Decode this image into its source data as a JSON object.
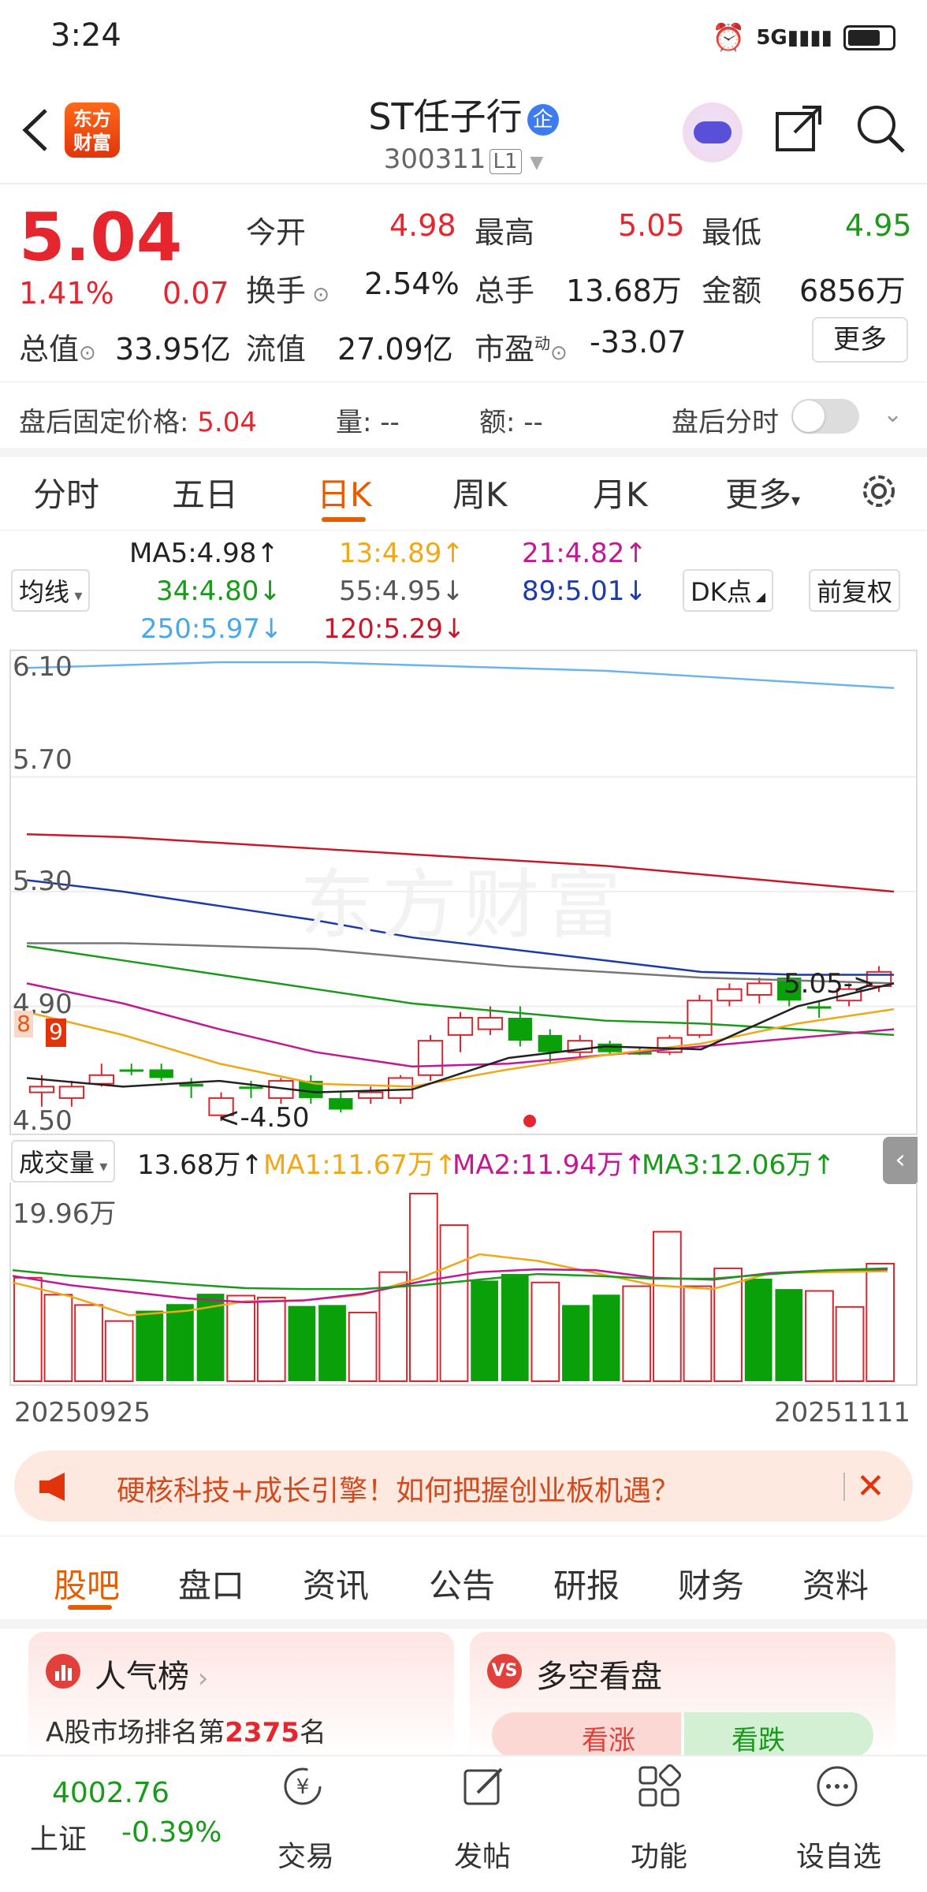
{
  "status": {
    "time": "3:24"
  },
  "header": {
    "title": "ST任子行",
    "badge": "企",
    "code": "300311",
    "level": "L1",
    "logo": "东方\n财富"
  },
  "quote": {
    "price": "5.04",
    "change_pct": "1.41%",
    "change": "0.07",
    "open_label": "今开",
    "open": "4.98",
    "high_label": "最高",
    "high": "5.05",
    "low_label": "最低",
    "low": "4.95",
    "turnover_label": "换手",
    "turnover": "2.54%",
    "volume_label": "总手",
    "volume": "13.68万",
    "amount_label": "金额",
    "amount": "6856万",
    "mktcap_label": "总值",
    "mktcap": "33.95亿",
    "float_label": "流值",
    "float": "27.09亿",
    "pe_label": "市盈",
    "pe_sup": "动",
    "pe": "-33.07",
    "more": "更多",
    "after_label": "盘后固定价格:",
    "after_price": "5.04",
    "after_vol": "量: --",
    "after_amt": "额: --",
    "after_time_label": "盘后分时"
  },
  "tabs": [
    "分时",
    "五日",
    "日K",
    "周K",
    "月K",
    "更多"
  ],
  "ma": {
    "select": "均线",
    "ma5": "MA5:4.98↑",
    "ma13": "13:4.89↑",
    "ma21": "21:4.82↑",
    "ma34": "34:4.80↓",
    "ma55": "55:4.95↓",
    "ma89": "89:5.01↓",
    "ma250": "250:5.97↓",
    "ma120": "120:5.29↓",
    "dk": "DK点",
    "adjust": "前复权"
  },
  "chart": {
    "y_labels": [
      "6.10",
      "5.70",
      "5.30",
      "4.90",
      "4.50"
    ],
    "annot_low": "<-4.50",
    "annot_high": "5.05->",
    "marker_8": "8",
    "marker_9": "9",
    "watermark": "东方财富"
  },
  "volume": {
    "select": "成交量",
    "vol": "13.68万↑",
    "ma1": "MA1:11.67万↑",
    "ma2": "MA2:11.94万↑",
    "ma3": "MA3:12.06万↑",
    "max": "19.96万",
    "date_start": "20250925",
    "date_end": "20251111"
  },
  "chart_data": {
    "type": "candlestick",
    "ylim": [
      4.5,
      6.1
    ],
    "candles": [
      {
        "o": 4.62,
        "c": 4.6,
        "h": 4.66,
        "l": 4.55,
        "up": true
      },
      {
        "o": 4.58,
        "c": 4.62,
        "h": 4.64,
        "l": 4.55,
        "up": true
      },
      {
        "o": 4.63,
        "c": 4.66,
        "h": 4.7,
        "l": 4.62,
        "up": true
      },
      {
        "o": 4.68,
        "c": 4.68,
        "h": 4.7,
        "l": 4.66,
        "up": false
      },
      {
        "o": 4.68,
        "c": 4.65,
        "h": 4.7,
        "l": 4.64,
        "up": false
      },
      {
        "o": 4.63,
        "c": 4.62,
        "h": 4.65,
        "l": 4.58,
        "up": false
      },
      {
        "o": 4.52,
        "c": 4.58,
        "h": 4.6,
        "l": 4.5,
        "up": true
      },
      {
        "o": 4.62,
        "c": 4.62,
        "h": 4.64,
        "l": 4.58,
        "up": false
      },
      {
        "o": 4.58,
        "c": 4.64,
        "h": 4.65,
        "l": 4.56,
        "up": true
      },
      {
        "o": 4.64,
        "c": 4.58,
        "h": 4.66,
        "l": 4.56,
        "up": false
      },
      {
        "o": 4.58,
        "c": 4.54,
        "h": 4.6,
        "l": 4.53,
        "up": false
      },
      {
        "o": 4.58,
        "c": 4.6,
        "h": 4.62,
        "l": 4.56,
        "up": true
      },
      {
        "o": 4.58,
        "c": 4.65,
        "h": 4.66,
        "l": 4.56,
        "up": true
      },
      {
        "o": 4.66,
        "c": 4.78,
        "h": 4.8,
        "l": 4.64,
        "up": true
      },
      {
        "o": 4.8,
        "c": 4.86,
        "h": 4.88,
        "l": 4.74,
        "up": true
      },
      {
        "o": 4.82,
        "c": 4.86,
        "h": 4.9,
        "l": 4.8,
        "up": true
      },
      {
        "o": 4.86,
        "c": 4.78,
        "h": 4.9,
        "l": 4.76,
        "up": false
      },
      {
        "o": 4.8,
        "c": 4.74,
        "h": 4.82,
        "l": 4.7,
        "up": false
      },
      {
        "o": 4.74,
        "c": 4.78,
        "h": 4.8,
        "l": 4.72,
        "up": true
      },
      {
        "o": 4.77,
        "c": 4.74,
        "h": 4.78,
        "l": 4.73,
        "up": false
      },
      {
        "o": 4.74,
        "c": 4.74,
        "h": 4.76,
        "l": 4.73,
        "up": false
      },
      {
        "o": 4.74,
        "c": 4.79,
        "h": 4.8,
        "l": 4.73,
        "up": true
      },
      {
        "o": 4.8,
        "c": 4.92,
        "h": 4.94,
        "l": 4.79,
        "up": true
      },
      {
        "o": 4.92,
        "c": 4.96,
        "h": 4.98,
        "l": 4.9,
        "up": true
      },
      {
        "o": 4.94,
        "c": 4.98,
        "h": 5.0,
        "l": 4.91,
        "up": true
      },
      {
        "o": 5.0,
        "c": 4.92,
        "h": 5.01,
        "l": 4.9,
        "up": false
      },
      {
        "o": 4.9,
        "c": 4.9,
        "h": 4.92,
        "l": 4.86,
        "up": false
      },
      {
        "o": 4.92,
        "c": 4.96,
        "h": 4.98,
        "l": 4.9,
        "up": true
      },
      {
        "o": 4.97,
        "c": 5.02,
        "h": 5.04,
        "l": 4.95,
        "up": true
      }
    ],
    "volumes": [
      11.0,
      9.2,
      8.1,
      6.4,
      7.5,
      8.2,
      9.3,
      9.1,
      8.9,
      8.0,
      8.1,
      7.3,
      11.6,
      19.96,
      16.6,
      10.7,
      11.4,
      10.5,
      8.1,
      9.2,
      10.1,
      15.9,
      10.1,
      12.0,
      10.9,
      9.8,
      9.6,
      7.9,
      12.5
    ],
    "volume_up": [
      true,
      true,
      true,
      true,
      false,
      false,
      false,
      true,
      true,
      false,
      false,
      true,
      true,
      true,
      true,
      false,
      false,
      true,
      false,
      false,
      true,
      true,
      true,
      true,
      false,
      false,
      true,
      true,
      true
    ]
  },
  "banner": {
    "text": "硬核科技+成长引擎！如何把握创业板机遇？"
  },
  "bottom_tabs": [
    "股吧",
    "盘口",
    "资讯",
    "公告",
    "研报",
    "财务",
    "资料"
  ],
  "cards": {
    "popular_title": "人气榜",
    "popular_text_a": "A股市场排名第",
    "popular_rank": "2375",
    "popular_text_b": "名",
    "sentiment_title": "多空看盘",
    "bull": "看涨",
    "bear": "看跌"
  },
  "nav": {
    "index_value": "4002.76",
    "index_name": "上证",
    "index_change": "-0.39%",
    "trade": "交易",
    "post": "发帖",
    "function": "功能",
    "watchlist": "设自选"
  }
}
